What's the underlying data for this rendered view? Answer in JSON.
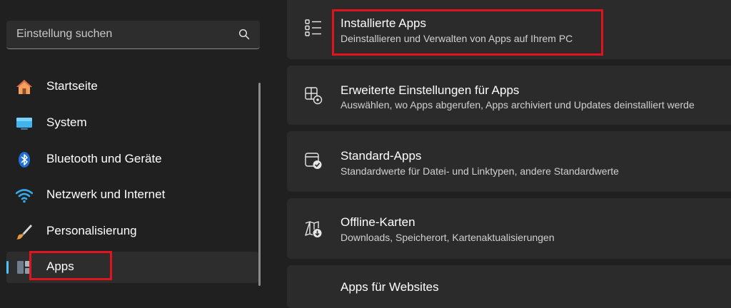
{
  "search": {
    "placeholder": "Einstellung suchen",
    "icon": "search-icon"
  },
  "sidebar": {
    "items": [
      {
        "label": "Startseite",
        "icon": "home-icon"
      },
      {
        "label": "System",
        "icon": "monitor-icon"
      },
      {
        "label": "Bluetooth und Geräte",
        "icon": "bluetooth-icon"
      },
      {
        "label": "Netzwerk und Internet",
        "icon": "wifi-icon"
      },
      {
        "label": "Personalisierung",
        "icon": "brush-icon"
      },
      {
        "label": "Apps",
        "icon": "apps-icon",
        "selected": true
      }
    ]
  },
  "main": {
    "cards": [
      {
        "title": "Installierte Apps",
        "desc": "Deinstallieren und Verwalten von Apps auf Ihrem PC",
        "icon": "list-icon"
      },
      {
        "title": "Erweiterte Einstellungen für Apps",
        "desc": "Auswählen, wo Apps abgerufen, Apps archiviert und Updates deinstalliert werde",
        "icon": "app-settings-icon"
      },
      {
        "title": "Standard-Apps",
        "desc": "Standardwerte für Datei- und Linktypen, andere Standardwerte",
        "icon": "default-apps-icon"
      },
      {
        "title": "Offline-Karten",
        "desc": "Downloads, Speicherort, Kartenaktualisierungen",
        "icon": "map-icon"
      },
      {
        "title": "Apps für Websites",
        "desc": "",
        "icon": "web-apps-icon"
      }
    ]
  },
  "colors": {
    "accent": "#4cc2ff",
    "highlight": "#e0141e",
    "background": "#202020",
    "card": "#2b2b2b"
  }
}
